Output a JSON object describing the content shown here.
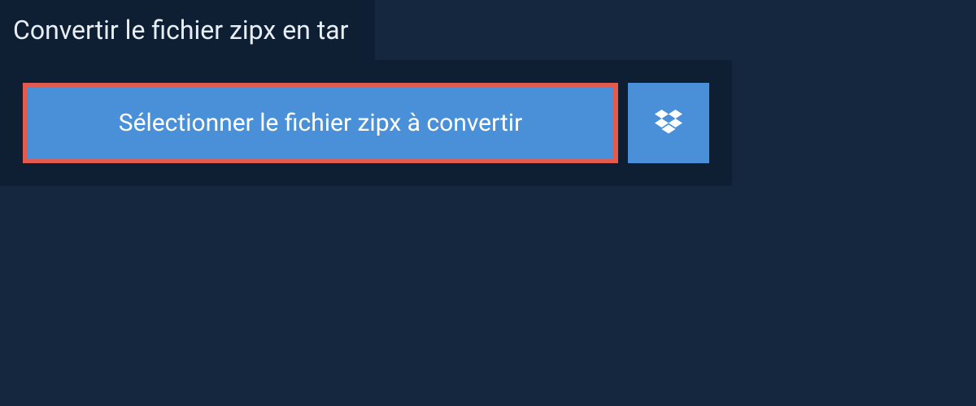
{
  "tab": {
    "title": "Convertir le fichier zipx en tar"
  },
  "actions": {
    "select_file_label": "Sélectionner le fichier zipx à convertir"
  },
  "colors": {
    "page_bg": "#15273e",
    "panel_bg": "#0e1e33",
    "button_bg": "#4990d8",
    "highlight_border": "#e25b4f",
    "text_light": "#e8eef5",
    "text_white": "#ffffff"
  }
}
